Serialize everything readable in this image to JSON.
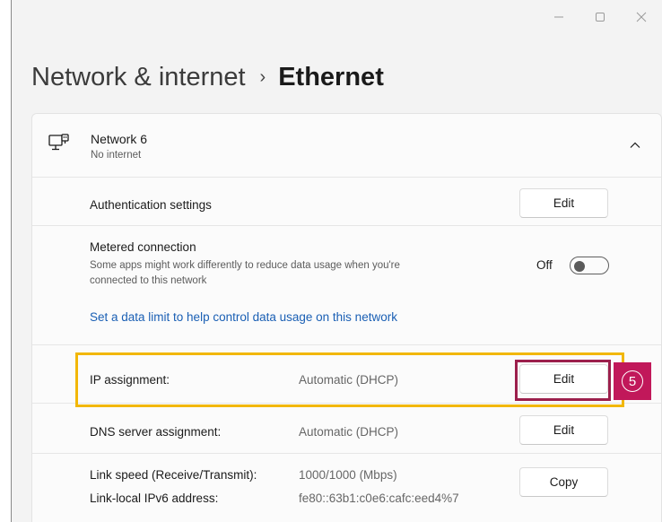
{
  "window": {
    "controls": [
      "minimize-icon",
      "maximize-icon",
      "close-icon"
    ]
  },
  "breadcrumb": {
    "parent": "Network & internet",
    "separator": "›",
    "current": "Ethernet"
  },
  "network": {
    "name": "Network 6",
    "status": "No internet",
    "icon": "ethernet-icon",
    "expander_icon": "chevron-up-icon"
  },
  "authentication": {
    "label": "Authentication settings",
    "button": "Edit"
  },
  "metered": {
    "label": "Metered connection",
    "description": "Some apps might work differently to reduce data usage when you're connected to this network",
    "toggle_label": "Off",
    "toggle_on": false,
    "link": "Set a data limit to help control data usage on this network"
  },
  "ip_assignment": {
    "label": "IP assignment:",
    "value": "Automatic (DHCP)",
    "button": "Edit"
  },
  "dns_assignment": {
    "label": "DNS server assignment:",
    "value": "Automatic (DHCP)",
    "button": "Edit"
  },
  "properties": {
    "link_speed_label": "Link speed (Receive/Transmit):",
    "link_speed_value": "1000/1000 (Mbps)",
    "ipv6_label": "Link-local IPv6 address:",
    "ipv6_value": "fe80::63b1:c0e6:cafc:eed4%7",
    "copy_button": "Copy"
  },
  "annotation": {
    "step": "5",
    "highlight_color": "#f2b705",
    "step_color": "#c1185a"
  }
}
